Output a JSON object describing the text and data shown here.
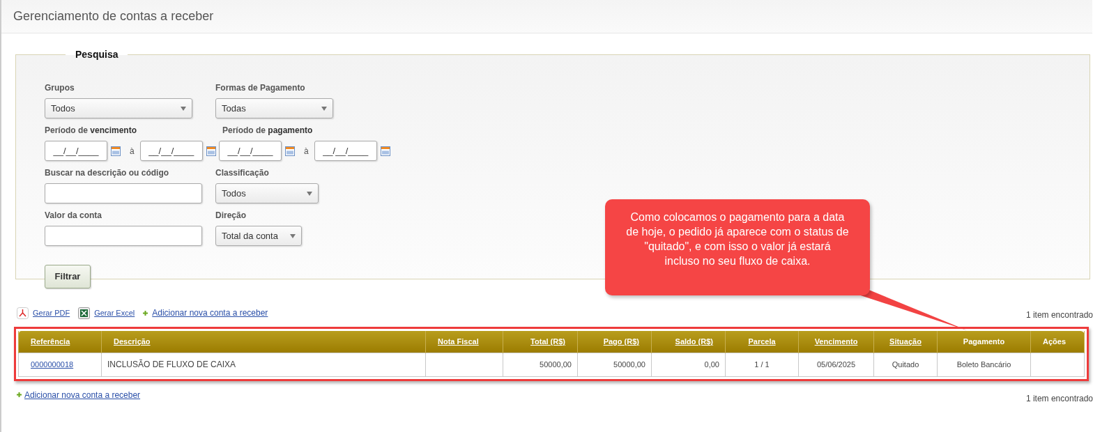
{
  "page_title": "Gerenciamento de contas a receber",
  "search": {
    "legend": "Pesquisa",
    "groups": {
      "label": "Grupos",
      "value": "Todos"
    },
    "payment_methods": {
      "label": "Formas de Pagamento",
      "value": "Todas"
    },
    "due_period": {
      "label": "Período de **vencimento**",
      "from": "__/__/____",
      "separator": "à",
      "to": "__/__/____"
    },
    "payment_period": {
      "label": "Período de **pagamento**",
      "from": "__/__/____",
      "separator": "à",
      "to": "__/__/____"
    },
    "description_search": {
      "label": "Buscar na descrição ou código"
    },
    "classification": {
      "label": "Classificação",
      "value": "Todos"
    },
    "account_value": {
      "label": "Valor da conta"
    },
    "direction": {
      "label": "Direção",
      "value": "Total da conta"
    },
    "filter_button": "Filtrar"
  },
  "callout": "Como colocamos o pagamento para a data de hoje, o pedido já aparece com o status de \"quitado\", e com isso o valor já estará incluso no seu fluxo de caixa.",
  "toolbar": [
    {
      "kind": "pdf",
      "label": "Gerar PDF"
    },
    {
      "kind": "excel",
      "label": "Gerar Excel"
    },
    {
      "kind": "add",
      "label": "Adicionar nova conta a receber"
    }
  ],
  "count_top": "1 item encontrado",
  "table": {
    "columns": [
      {
        "label": "Referência",
        "sortable": true
      },
      {
        "label": "Descrição",
        "sortable": true
      },
      {
        "label": "Nota Fiscal",
        "sortable": true
      },
      {
        "label": "Total (R$)",
        "sortable": true
      },
      {
        "label": "Pago (R$)",
        "sortable": true
      },
      {
        "label": "Saldo (R$)",
        "sortable": true
      },
      {
        "label": "Parcela",
        "sortable": true
      },
      {
        "label": "Vencimento",
        "sortable": true
      },
      {
        "label": "Situação",
        "sortable": true
      },
      {
        "label": "Pagamento",
        "sortable": false
      },
      {
        "label": "Ações",
        "sortable": false
      }
    ],
    "rows": [
      [
        "0000000018",
        "INCLUSÃO DE FLUXO DE CAIXA",
        "",
        "50000,00",
        "50000,00",
        "0,00",
        "1 / 1",
        "05/06/2025",
        "Quitado",
        "Boleto Bancário",
        ""
      ]
    ]
  },
  "add_link_bottom": "Adicionar nova conta a receber",
  "count_bottom": "1 item encontrado"
}
